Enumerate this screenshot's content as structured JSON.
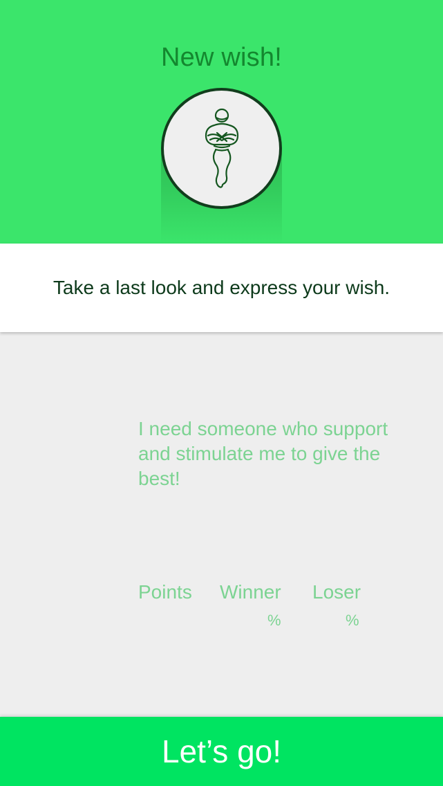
{
  "header": {
    "title": "New wish!",
    "avatar_icon": "genie-icon",
    "background_color": "#3be56b"
  },
  "instruction": {
    "text": "Take a last look and express your wish."
  },
  "wish": {
    "text": "I need someone who support and stimulate me to give the best!"
  },
  "stats": {
    "points_label": "Points",
    "winner_label": "Winner",
    "winner_unit": "%",
    "loser_label": "Loser",
    "loser_unit": "%"
  },
  "footer": {
    "button_label": "Let’s go!",
    "button_color": "#00e461"
  }
}
